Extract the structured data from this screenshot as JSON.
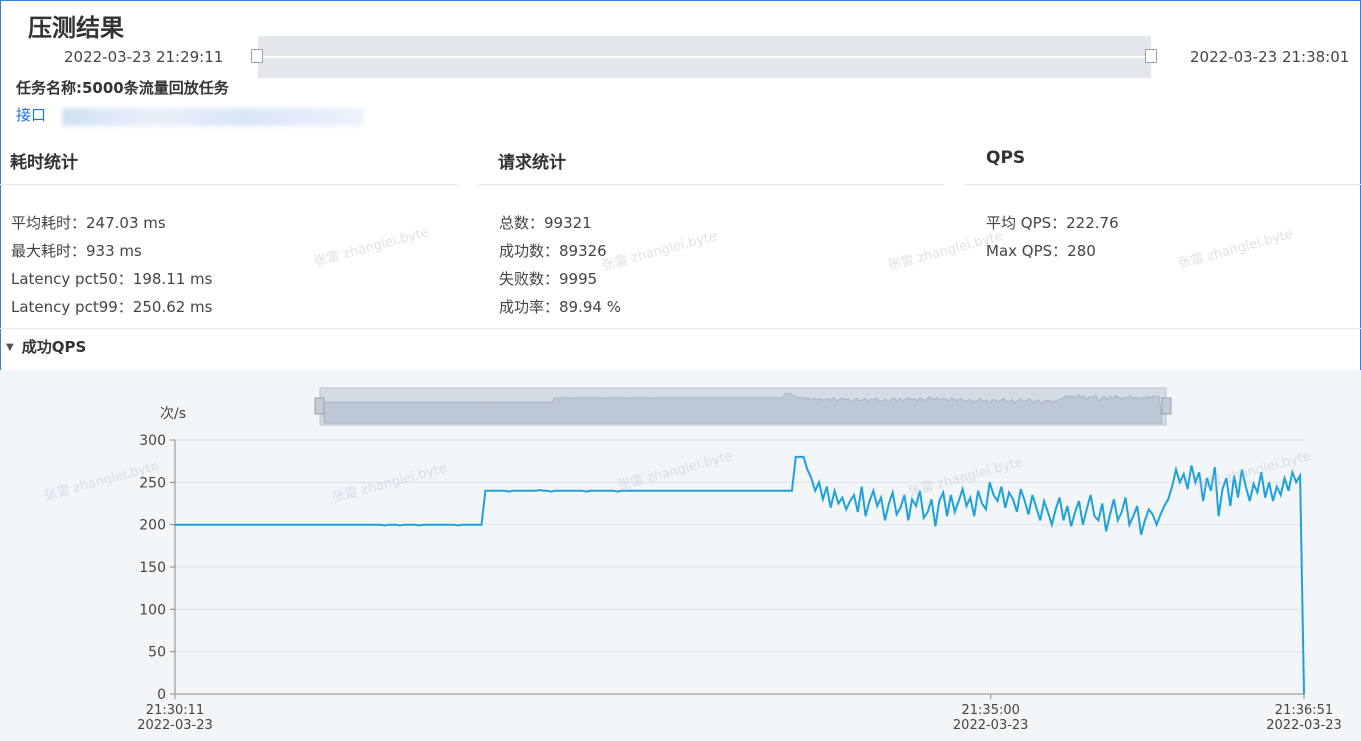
{
  "header": {
    "title": "压测结果",
    "time_start": "2022-03-23 21:29:11",
    "time_end": "2022-03-23 21:38:01",
    "task_name": "任务名称:5000条流量回放任务",
    "interface_label": "接口"
  },
  "sections": {
    "latency": {
      "title": "耗时统计",
      "avg": "平均耗时：247.03 ms",
      "max": "最大耗时：933 ms",
      "p50": "Latency pct50：198.11 ms",
      "p99": "Latency pct99：250.62 ms"
    },
    "requests": {
      "title": "请求统计",
      "total": "总数：99321",
      "success": "成功数：89326",
      "failed": "失败数：9995",
      "rate": "成功率：89.94 %"
    },
    "qps": {
      "title": "QPS",
      "avg": "平均 QPS：222.76",
      "max": "Max QPS：280"
    }
  },
  "collapse": {
    "label": "成功QPS",
    "icon": "triangle-down-icon"
  },
  "watermark": "张雷 zhanglei.byte",
  "colors": {
    "line": "#1ea1db",
    "accent": "#1a73e8",
    "chart_bg": "#f3f6f9"
  },
  "chart_data": {
    "type": "line",
    "ylabel": "次/s",
    "ylim": [
      0,
      300
    ],
    "yticks": [
      "0",
      "50",
      "100",
      "150",
      "200",
      "250",
      "300"
    ],
    "xticks": [
      {
        "time": "21:30:11",
        "date": "2022-03-23"
      },
      {
        "time": "21:35:00",
        "date": "2022-03-23"
      },
      {
        "time": "21:36:51",
        "date": "2022-03-23"
      }
    ],
    "series": [
      {
        "values": [
          200,
          200,
          200,
          200,
          200,
          200,
          200,
          200,
          200,
          200,
          200,
          200,
          200,
          200,
          200,
          200,
          200,
          200,
          200,
          200,
          200,
          200,
          200,
          200,
          200,
          200,
          200,
          200,
          200,
          200,
          200,
          200,
          200,
          200,
          200,
          200,
          200,
          200,
          200,
          200,
          200,
          200,
          200,
          200,
          200,
          200,
          200,
          200,
          200,
          200,
          200,
          200,
          200,
          200,
          199,
          200,
          200,
          200,
          199,
          200,
          200,
          200,
          200,
          199,
          200,
          200,
          200,
          200,
          200,
          200,
          200,
          200,
          200,
          199,
          200,
          200,
          200,
          200,
          200,
          200,
          240,
          240,
          240,
          240,
          240,
          240,
          239,
          240,
          240,
          240,
          240,
          240,
          240,
          240,
          241,
          240,
          240,
          239,
          240,
          240,
          240,
          240,
          240,
          240,
          240,
          240,
          239,
          240,
          240,
          240,
          240,
          240,
          240,
          240,
          239,
          240,
          240,
          240,
          240,
          240,
          240,
          240,
          240,
          240,
          240,
          240,
          240,
          240,
          240,
          240,
          240,
          240,
          240,
          240,
          240,
          240,
          240,
          240,
          240,
          240,
          240,
          240,
          240,
          240,
          240,
          240,
          240,
          240,
          240,
          240,
          240,
          240,
          240,
          240,
          240,
          240,
          240,
          240,
          240,
          240,
          280,
          280,
          280,
          265,
          255,
          240,
          250,
          230,
          245,
          220,
          240,
          225,
          232,
          218,
          228,
          235,
          215,
          245,
          210,
          228,
          240,
          222,
          232,
          205,
          225,
          238,
          212,
          220,
          235,
          205,
          230,
          222,
          240,
          208,
          215,
          230,
          198,
          228,
          238,
          210,
          235,
          215,
          228,
          242,
          222,
          232,
          210,
          240,
          225,
          218,
          250,
          235,
          228,
          245,
          220,
          238,
          230,
          215,
          242,
          228,
          212,
          235,
          220,
          205,
          228,
          215,
          200,
          218,
          232,
          205,
          222,
          198,
          215,
          228,
          200,
          218,
          235,
          210,
          205,
          225,
          192,
          212,
          230,
          205,
          215,
          232,
          200,
          210,
          222,
          188,
          205,
          218,
          212,
          200,
          212,
          222,
          230,
          245,
          265,
          250,
          260,
          242,
          270,
          250,
          262,
          228,
          255,
          240,
          268,
          210,
          242,
          255,
          222,
          258,
          232,
          265,
          245,
          228,
          248,
          238,
          262,
          232,
          250,
          228,
          245,
          235,
          255,
          240,
          262,
          250,
          258,
          0
        ]
      }
    ]
  }
}
